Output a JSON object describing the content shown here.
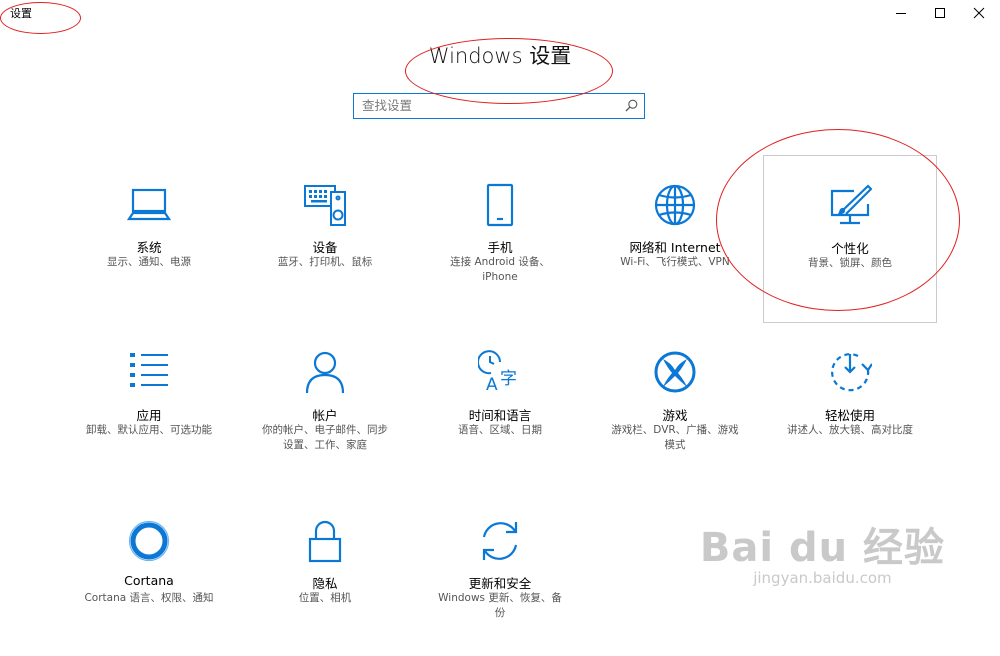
{
  "window": {
    "app_title": "设置",
    "minimize_label": "minimize",
    "maximize_label": "maximize",
    "close_label": "close"
  },
  "heading": "Windows 设置",
  "search": {
    "placeholder": "查找设置",
    "value": ""
  },
  "colors": {
    "accent": "#0a78d4",
    "annotation": "#e02020"
  },
  "tiles": [
    {
      "id": "system",
      "label": "系统",
      "desc": [
        "显示、通知、电源"
      ],
      "icon": "laptop-icon"
    },
    {
      "id": "devices",
      "label": "设备",
      "desc": [
        "蓝牙、打印机、鼠标"
      ],
      "icon": "keyboard-speaker-icon"
    },
    {
      "id": "phone",
      "label": "手机",
      "desc": [
        "连接 Android 设备、",
        "iPhone"
      ],
      "icon": "phone-icon"
    },
    {
      "id": "network",
      "label": "网络和 Internet",
      "desc": [
        "Wi-Fi、飞行模式、VPN"
      ],
      "icon": "globe-icon"
    },
    {
      "id": "personalization",
      "label": "个性化",
      "desc": [
        "背景、锁屏、颜色"
      ],
      "icon": "paint-monitor-icon"
    },
    {
      "id": "apps",
      "label": "应用",
      "desc": [
        "卸载、默认应用、可选功能"
      ],
      "icon": "list-icon"
    },
    {
      "id": "accounts",
      "label": "帐户",
      "desc": [
        "你的帐户、电子邮件、同步",
        "设置、工作、家庭"
      ],
      "icon": "person-icon"
    },
    {
      "id": "time-language",
      "label": "时间和语言",
      "desc": [
        "语音、区域、日期"
      ],
      "icon": "clock-language-icon"
    },
    {
      "id": "gaming",
      "label": "游戏",
      "desc": [
        "游戏栏、DVR、广播、游戏",
        "模式"
      ],
      "icon": "xbox-icon"
    },
    {
      "id": "ease-of-access",
      "label": "轻松使用",
      "desc": [
        "讲述人、放大镜、高对比度"
      ],
      "icon": "ease-of-access-icon"
    },
    {
      "id": "cortana",
      "label": "Cortana",
      "desc": [
        "Cortana 语言、权限、通知"
      ],
      "icon": "cortana-ring-icon"
    },
    {
      "id": "privacy",
      "label": "隐私",
      "desc": [
        "位置、相机"
      ],
      "icon": "lock-icon"
    },
    {
      "id": "update-security",
      "label": "更新和安全",
      "desc": [
        "Windows 更新、恢复、备",
        "份"
      ],
      "icon": "sync-arrows-icon"
    }
  ],
  "watermark": {
    "brand": "Bai du 经验",
    "url": "jingyan.baidu.com"
  }
}
